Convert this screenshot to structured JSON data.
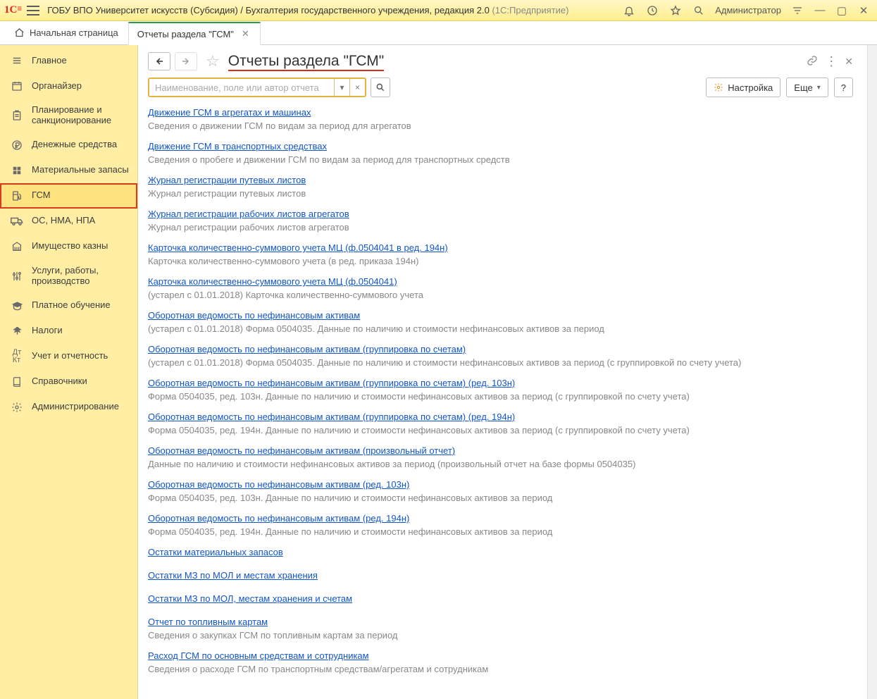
{
  "titlebar": {
    "org": "ГОБУ ВПО Университет искусств (Субсидия) / Бухгалтерия государственного учреждения, редакция 2.0 ",
    "platform": " (1С:Предприятие)",
    "user": "Администратор"
  },
  "tabs": {
    "home": "Начальная страница",
    "current": "Отчеты раздела \"ГСМ\""
  },
  "sidebar": [
    {
      "label": "Главное"
    },
    {
      "label": "Органайзер"
    },
    {
      "label": "Планирование и санкционирование"
    },
    {
      "label": "Денежные средства"
    },
    {
      "label": "Материальные запасы"
    },
    {
      "label": "ГСМ"
    },
    {
      "label": "ОС, НМА, НПА"
    },
    {
      "label": "Имущество казны"
    },
    {
      "label": "Услуги, работы, производство"
    },
    {
      "label": "Платное обучение"
    },
    {
      "label": "Налоги"
    },
    {
      "label": "Учет и отчетность"
    },
    {
      "label": "Справочники"
    },
    {
      "label": "Администрирование"
    }
  ],
  "page": {
    "title": "Отчеты раздела \"ГСМ\"",
    "search_placeholder": "Наименование, поле или автор отчета",
    "settings_btn": "Настройка",
    "more_btn": "Еще",
    "help_btn": "?"
  },
  "reports": [
    {
      "title": "Движение ГСМ в агрегатах и машинах",
      "desc": "Сведения о движении ГСМ по видам за период для агрегатов"
    },
    {
      "title": "Движение ГСМ в транспортных средствах",
      "desc": "Сведения о пробеге и движении ГСМ по видам за период для транспортных средств"
    },
    {
      "title": "Журнал регистрации путевых листов",
      "desc": "Журнал регистрации путевых листов"
    },
    {
      "title": "Журнал регистрации рабочих листов агрегатов",
      "desc": "Журнал регистрации рабочих листов агрегатов"
    },
    {
      "title": "Карточка количественно-суммового учета МЦ  (ф.0504041 в ред. 194н)",
      "desc": "Карточка количественно-суммового учета (в ред. приказа 194н)"
    },
    {
      "title": "Карточка количественно-суммового учета МЦ  (ф.0504041)",
      "desc": "(устарел с 01.01.2018) Карточка количественно-суммового учета"
    },
    {
      "title": "Оборотная ведомость по нефинансовым активам",
      "desc": "(устарел с 01.01.2018) Форма 0504035. Данные по наличию и стоимости нефинансовых активов за период"
    },
    {
      "title": "Оборотная ведомость по нефинансовым активам (группировка по счетам)",
      "desc": "(устарел с 01.01.2018) Форма 0504035. Данные по наличию и стоимости нефинансовых активов за период (с группировкой по счету учета)"
    },
    {
      "title": "Оборотная ведомость по нефинансовым активам (группировка по счетам) (ред. 103н)",
      "desc": "Форма 0504035, ред. 103н. Данные по наличию и стоимости нефинансовых активов за период (с группировкой по счету учета)"
    },
    {
      "title": "Оборотная ведомость по нефинансовым активам (группировка по счетам) (ред. 194н)",
      "desc": "Форма 0504035, ред. 194н. Данные по наличию и стоимости нефинансовых активов за период (с группировкой по счету учета)"
    },
    {
      "title": "Оборотная ведомость по нефинансовым активам (произвольный отчет)",
      "desc": "Данные по наличию и стоимости нефинансовых активов за период (произвольный отчет на базе формы 0504035)"
    },
    {
      "title": "Оборотная ведомость по нефинансовым активам (ред. 103н)",
      "desc": "Форма 0504035, ред. 103н. Данные по наличию и стоимости нефинансовых активов за период"
    },
    {
      "title": "Оборотная ведомость по нефинансовым активам (ред. 194н)",
      "desc": "Форма 0504035, ред. 194н. Данные по наличию и стоимости нефинансовых активов за период"
    },
    {
      "title": "Остатки материальных запасов",
      "desc": ""
    },
    {
      "title": "Остатки МЗ по МОЛ и местам хранения",
      "desc": ""
    },
    {
      "title": "Остатки МЗ по МОЛ, местам хранения и счетам",
      "desc": ""
    },
    {
      "title": "Отчет по топливным картам",
      "desc": "Сведения о закупках ГСМ по топливным картам за период"
    },
    {
      "title": "Расход ГСМ по основным средствам и сотрудникам",
      "desc": "Сведения о расходе ГСМ по транспортным средствам/агрегатам и сотрудникам"
    }
  ]
}
